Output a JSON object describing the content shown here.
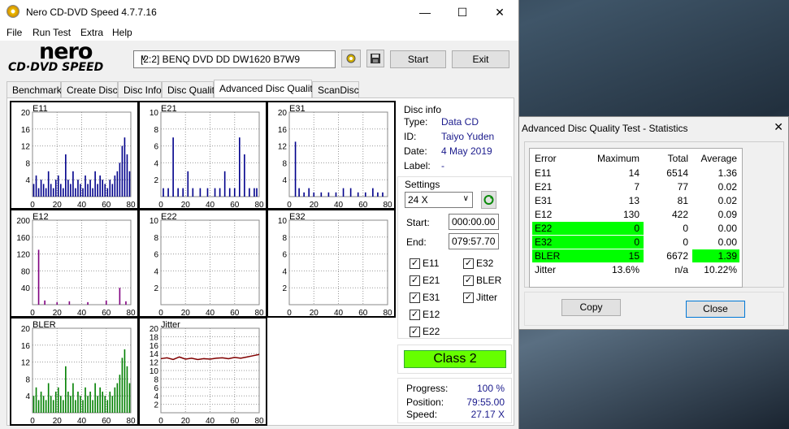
{
  "main_window": {
    "title": "Nero CD-DVD Speed 4.7.7.16",
    "menu": [
      "File",
      "Run Test",
      "Extra",
      "Help"
    ],
    "logo_top": "nero",
    "logo_bottom": "CD·DVD SPEED",
    "drive": "[2:2]   BENQ DVD DD DW1620 B7W9",
    "start_label": "Start",
    "exit_label": "Exit",
    "tabs": [
      "Benchmark",
      "Create Disc",
      "Disc Info",
      "Disc Quality",
      "Advanced Disc Quality",
      "ScanDisc"
    ],
    "active_tab": "Advanced Disc Quality"
  },
  "disc_info": {
    "group_label": "Disc info",
    "type_label": "Type:",
    "type": "Data CD",
    "id_label": "ID:",
    "id": "Taiyo Yuden",
    "date_label": "Date:",
    "date": "4 May 2019",
    "label_label": "Label:",
    "label": "-"
  },
  "settings": {
    "group_label": "Settings",
    "speed": "24 X",
    "start_label": "Start:",
    "start": "000:00.00",
    "end_label": "End:",
    "end": "079:57.70",
    "checkboxes": [
      {
        "label": "E11",
        "checked": true
      },
      {
        "label": "E32",
        "checked": true
      },
      {
        "label": "E21",
        "checked": true
      },
      {
        "label": "BLER",
        "checked": true
      },
      {
        "label": "E31",
        "checked": true
      },
      {
        "label": "Jitter",
        "checked": true
      },
      {
        "label": "E12",
        "checked": true
      },
      {
        "label": "E22",
        "checked": true
      }
    ]
  },
  "class_label": "Class 2",
  "progress": {
    "progress_label": "Progress:",
    "progress": "100 %",
    "position_label": "Position:",
    "position": "79:55.00",
    "speed_label": "Speed:",
    "speed": "27.17 X"
  },
  "chart_data": [
    {
      "type": "bar",
      "title": "E11",
      "color": "#00008b",
      "xlim": [
        0,
        80
      ],
      "ylim": [
        0,
        20
      ],
      "yticks": [
        4,
        8,
        12,
        16,
        20
      ],
      "xticks": [
        0,
        20,
        40,
        60,
        80
      ],
      "x": [
        1,
        3,
        5,
        7,
        9,
        11,
        13,
        15,
        17,
        19,
        21,
        23,
        25,
        27,
        29,
        31,
        33,
        35,
        37,
        39,
        41,
        43,
        45,
        47,
        49,
        51,
        53,
        55,
        57,
        59,
        61,
        63,
        65,
        67,
        69,
        71,
        73,
        75,
        77,
        79
      ],
      "values": [
        3,
        5,
        2,
        4,
        3,
        2,
        6,
        3,
        2,
        4,
        5,
        3,
        2,
        10,
        4,
        3,
        6,
        2,
        4,
        3,
        2,
        5,
        3,
        4,
        2,
        6,
        3,
        5,
        4,
        3,
        2,
        4,
        3,
        5,
        6,
        8,
        12,
        14,
        10,
        6
      ]
    },
    {
      "type": "bar",
      "title": "E21",
      "color": "#00008b",
      "xlim": [
        0,
        80
      ],
      "ylim": [
        0,
        10
      ],
      "yticks": [
        2,
        4,
        6,
        8,
        10
      ],
      "xticks": [
        0,
        20,
        40,
        60,
        80
      ],
      "x": [
        2,
        6,
        10,
        14,
        18,
        22,
        26,
        32,
        38,
        44,
        48,
        52,
        56,
        60,
        64,
        68,
        72,
        76,
        78
      ],
      "values": [
        1,
        1,
        7,
        1,
        1,
        3,
        1,
        1,
        1,
        1,
        1,
        3,
        1,
        1,
        7,
        5,
        1,
        1,
        1
      ]
    },
    {
      "type": "bar",
      "title": "E31",
      "color": "#00008b",
      "xlim": [
        0,
        80
      ],
      "ylim": [
        0,
        20
      ],
      "yticks": [
        4,
        8,
        12,
        16,
        20
      ],
      "xticks": [
        0,
        20,
        40,
        60,
        80
      ],
      "x": [
        5,
        8,
        12,
        16,
        20,
        26,
        32,
        38,
        44,
        50,
        56,
        62,
        68,
        72,
        76
      ],
      "values": [
        13,
        2,
        1,
        2,
        1,
        1,
        1,
        1,
        2,
        2,
        1,
        1,
        2,
        1,
        1
      ]
    },
    {
      "type": "bar",
      "title": "E12",
      "color": "#800080",
      "xlim": [
        0,
        80
      ],
      "ylim": [
        0,
        200
      ],
      "yticks": [
        40,
        80,
        120,
        160,
        200
      ],
      "xticks": [
        0,
        20,
        40,
        60,
        80
      ],
      "x": [
        5,
        10,
        20,
        30,
        45,
        60,
        71,
        76
      ],
      "values": [
        130,
        10,
        6,
        8,
        6,
        10,
        40,
        8
      ]
    },
    {
      "type": "bar",
      "title": "E22",
      "color": "#800080",
      "xlim": [
        0,
        80
      ],
      "ylim": [
        0,
        10
      ],
      "yticks": [
        2,
        4,
        6,
        8,
        10
      ],
      "xticks": [
        0,
        20,
        40,
        60,
        80
      ],
      "x": [],
      "values": []
    },
    {
      "type": "bar",
      "title": "E32",
      "color": "#800080",
      "xlim": [
        0,
        80
      ],
      "ylim": [
        0,
        10
      ],
      "yticks": [
        2,
        4,
        6,
        8,
        10
      ],
      "xticks": [
        0,
        20,
        40,
        60,
        80
      ],
      "x": [],
      "values": []
    },
    {
      "type": "bar",
      "title": "BLER",
      "color": "#008000",
      "xlim": [
        0,
        80
      ],
      "ylim": [
        0,
        20
      ],
      "yticks": [
        4,
        8,
        12,
        16,
        20
      ],
      "xticks": [
        0,
        20,
        40,
        60,
        80
      ],
      "x": [
        1,
        3,
        5,
        7,
        9,
        11,
        13,
        15,
        17,
        19,
        21,
        23,
        25,
        27,
        29,
        31,
        33,
        35,
        37,
        39,
        41,
        43,
        45,
        47,
        49,
        51,
        53,
        55,
        57,
        59,
        61,
        63,
        65,
        67,
        69,
        71,
        73,
        75,
        77,
        79
      ],
      "values": [
        4,
        6,
        3,
        5,
        4,
        3,
        7,
        4,
        3,
        5,
        6,
        4,
        3,
        11,
        5,
        4,
        7,
        3,
        5,
        4,
        3,
        6,
        4,
        5,
        3,
        7,
        4,
        6,
        5,
        4,
        3,
        5,
        4,
        6,
        7,
        9,
        13,
        15,
        11,
        7
      ]
    },
    {
      "type": "line",
      "title": "Jitter",
      "color": "#800000",
      "xlim": [
        0,
        80
      ],
      "ylim": [
        0,
        20
      ],
      "yticks": [
        2,
        4,
        6,
        8,
        10,
        12,
        14,
        16,
        18,
        20
      ],
      "xticks": [
        0,
        20,
        40,
        60,
        80
      ],
      "x": [
        0,
        5,
        10,
        15,
        20,
        25,
        30,
        35,
        40,
        45,
        50,
        55,
        60,
        65,
        70,
        75,
        80
      ],
      "values": [
        12.8,
        13.0,
        12.6,
        13.2,
        12.7,
        12.9,
        12.6,
        12.8,
        12.7,
        12.9,
        13.0,
        12.8,
        13.1,
        12.9,
        13.2,
        13.5,
        13.8
      ]
    }
  ],
  "stats_window": {
    "title": "Advanced Disc Quality Test - Statistics",
    "headers": [
      "Error",
      "Maximum",
      "Total",
      "Average"
    ],
    "rows": [
      {
        "name": "E11",
        "max": "14",
        "total": "6514",
        "avg": "1.36"
      },
      {
        "name": "E21",
        "max": "7",
        "total": "77",
        "avg": "0.02"
      },
      {
        "name": "E31",
        "max": "13",
        "total": "81",
        "avg": "0.02"
      },
      {
        "name": "E12",
        "max": "130",
        "total": "422",
        "avg": "0.09"
      },
      {
        "name": "E22",
        "max": "0",
        "total": "0",
        "avg": "0.00"
      },
      {
        "name": "E32",
        "max": "0",
        "total": "0",
        "avg": "0.00"
      },
      {
        "name": "BLER",
        "max": "15",
        "total": "6672",
        "avg": "1.39"
      },
      {
        "name": "Jitter",
        "max": "13.6%",
        "total": "n/a",
        "avg": "10.22%"
      }
    ],
    "highlight_color": "#00ff00",
    "bler_highlight_color": "#7fff00",
    "copy_label": "Copy",
    "close_label": "Close"
  }
}
